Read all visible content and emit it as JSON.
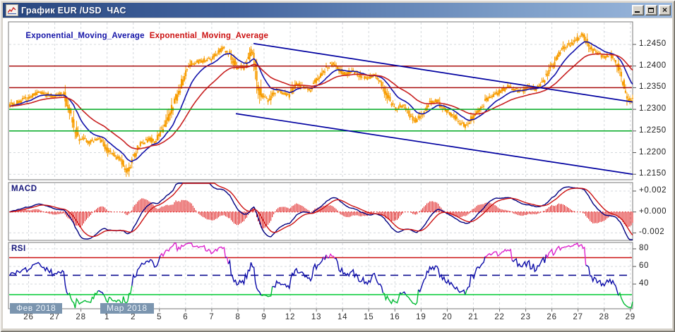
{
  "window": {
    "title": "График EUR /USD  ЧАС",
    "controls": {
      "minimize": "_",
      "maximize": "□",
      "close": "×"
    }
  },
  "legend": {
    "ema_blue": "Exponential_Moving_Average",
    "ema_red": "Exponential_Moving_Average",
    "macd": "MACD",
    "rsi": "RSI"
  },
  "axes": {
    "price_ticks": [
      "1.2450",
      "1.2400",
      "1.2350",
      "1.2300",
      "1.2250",
      "1.2200",
      "1.2150"
    ],
    "macd_ticks": [
      "+0.002",
      "+0.000",
      "-0.002"
    ],
    "rsi_ticks": [
      "80",
      "60",
      "40"
    ],
    "date_ticks": [
      "26",
      "27",
      "28",
      "1",
      "2",
      "5",
      "6",
      "7",
      "8",
      "9",
      "12",
      "13",
      "14",
      "15",
      "16",
      "19",
      "20",
      "21",
      "22",
      "23",
      "26",
      "27",
      "28",
      "29"
    ],
    "month_badges": [
      {
        "label": "Фев 2018",
        "x": 10
      },
      {
        "label": "Мар 2018",
        "x": 138
      }
    ]
  },
  "colors": {
    "titlebar_left": "#27467f",
    "titlebar_right": "#9ab7dc",
    "candle": "#f79c00",
    "ema_fast": "#1111aa",
    "ema_slow": "#c82020",
    "level_red": "#aa1111",
    "level_green": "#00aa22",
    "trendline": "#0000a0",
    "macd_line": "#000080",
    "macd_signal": "#cc1111",
    "macd_hist": "#dd1111",
    "rsi_line": "#0a0aa8",
    "rsi_overbought_seg": "#dd22cc",
    "rsi_oversold_seg": "#00bb33",
    "rsi_line70": "#cc1111",
    "rsi_line28": "#00cc33",
    "rsi_line50": "#00008b",
    "grid": "#d4d8dc",
    "panel_border": "#7a7a7a",
    "badge_bg": "#7b95af"
  },
  "chart_data": [
    {
      "type": "candlestick",
      "title": "EUR/USD 1 hour",
      "bars": 440,
      "ylim": [
        1.215,
        1.245
      ],
      "price_step": 0.005,
      "price_path": [
        [
          0,
          1.231
        ],
        [
          0.025,
          1.2325
        ],
        [
          0.048,
          1.234
        ],
        [
          0.07,
          1.233
        ],
        [
          0.087,
          1.2338
        ],
        [
          0.098,
          1.229
        ],
        [
          0.11,
          1.2235
        ],
        [
          0.127,
          1.2225
        ],
        [
          0.144,
          1.2232
        ],
        [
          0.161,
          1.22
        ],
        [
          0.178,
          1.2185
        ],
        [
          0.189,
          1.2158
        ],
        [
          0.206,
          1.2215
        ],
        [
          0.223,
          1.2232
        ],
        [
          0.234,
          1.2226
        ],
        [
          0.251,
          1.2268
        ],
        [
          0.268,
          1.233
        ],
        [
          0.279,
          1.2372
        ],
        [
          0.291,
          1.2405
        ],
        [
          0.308,
          1.2412
        ],
        [
          0.325,
          1.2418
        ],
        [
          0.342,
          1.2442
        ],
        [
          0.353,
          1.243
        ],
        [
          0.364,
          1.24
        ],
        [
          0.376,
          1.2396
        ],
        [
          0.389,
          1.2438
        ],
        [
          0.396,
          1.2372
        ],
        [
          0.404,
          1.233
        ],
        [
          0.415,
          1.2322
        ],
        [
          0.427,
          1.2345
        ],
        [
          0.438,
          1.234
        ],
        [
          0.449,
          1.2332
        ],
        [
          0.46,
          1.236
        ],
        [
          0.472,
          1.2352
        ],
        [
          0.483,
          1.2346
        ],
        [
          0.494,
          1.2372
        ],
        [
          0.506,
          1.2392
        ],
        [
          0.517,
          1.2406
        ],
        [
          0.528,
          1.2392
        ],
        [
          0.54,
          1.2382
        ],
        [
          0.551,
          1.239
        ],
        [
          0.562,
          1.238
        ],
        [
          0.574,
          1.2372
        ],
        [
          0.585,
          1.238
        ],
        [
          0.596,
          1.236
        ],
        [
          0.607,
          1.233
        ],
        [
          0.619,
          1.2302
        ],
        [
          0.63,
          1.2312
        ],
        [
          0.641,
          1.229
        ],
        [
          0.653,
          1.2272
        ],
        [
          0.664,
          1.2292
        ],
        [
          0.675,
          1.2316
        ],
        [
          0.687,
          1.232
        ],
        [
          0.698,
          1.23
        ],
        [
          0.709,
          1.229
        ],
        [
          0.721,
          1.2272
        ],
        [
          0.732,
          1.2262
        ],
        [
          0.743,
          1.2282
        ],
        [
          0.754,
          1.2302
        ],
        [
          0.766,
          1.2322
        ],
        [
          0.777,
          1.2332
        ],
        [
          0.788,
          1.2342
        ],
        [
          0.8,
          1.2352
        ],
        [
          0.811,
          1.2346
        ],
        [
          0.822,
          1.2342
        ],
        [
          0.834,
          1.2352
        ],
        [
          0.845,
          1.2346
        ],
        [
          0.856,
          1.2362
        ],
        [
          0.868,
          1.2392
        ],
        [
          0.879,
          1.2422
        ],
        [
          0.89,
          1.2442
        ],
        [
          0.902,
          1.2452
        ],
        [
          0.913,
          1.2466
        ],
        [
          0.921,
          1.2472
        ],
        [
          0.93,
          1.2446
        ],
        [
          0.941,
          1.2432
        ],
        [
          0.952,
          1.2422
        ],
        [
          0.964,
          1.2426
        ],
        [
          0.973,
          1.2412
        ],
        [
          0.981,
          1.2382
        ],
        [
          0.989,
          1.2342
        ],
        [
          0.995,
          1.232
        ],
        [
          1,
          1.2326
        ]
      ],
      "emas": [
        {
          "period": 15
        },
        {
          "period": 40
        }
      ],
      "horizontal_lines": [
        {
          "price": 1.24,
          "color": "red"
        },
        {
          "price": 1.235,
          "color": "red"
        },
        {
          "price": 1.23,
          "color": "green"
        },
        {
          "price": 1.225,
          "color": "green"
        }
      ],
      "trendlines": [
        {
          "x1": 0.3926,
          "p1": 1.2452,
          "x2": 1.0,
          "p2": 1.2317
        },
        {
          "x1": 0.3643,
          "p1": 1.229,
          "x2": 1.0,
          "p2": 1.215
        }
      ]
    },
    {
      "type": "line+histogram",
      "name": "MACD",
      "fast": 12,
      "slow": 26,
      "signal": 9,
      "ylim": [
        -0.0028,
        0.0028
      ],
      "tick_values": [
        0.002,
        0.0,
        -0.002
      ]
    },
    {
      "type": "line",
      "name": "RSI",
      "period": 14,
      "ylim": [
        12,
        86
      ],
      "tick_values": [
        80,
        60,
        40
      ],
      "levels": {
        "overbought": 70,
        "middle": 50,
        "oversold": 28
      }
    }
  ]
}
